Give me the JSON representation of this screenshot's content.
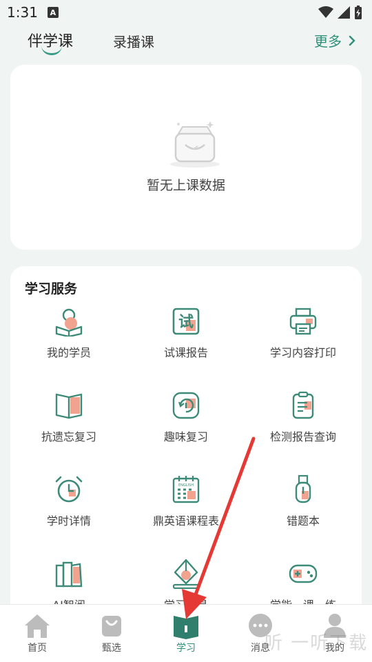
{
  "status_bar": {
    "time": "1:31",
    "notification_glyph": "A"
  },
  "tabs": {
    "items": [
      {
        "label": "伴学课"
      },
      {
        "label": "录播课"
      }
    ],
    "more_label": "更多",
    "more_arrow": "›"
  },
  "empty_state": {
    "text": "暂无上课数据"
  },
  "services": {
    "title": "学习服务",
    "items": [
      {
        "label": "我的学员",
        "icon": "student-reading-icon"
      },
      {
        "label": "试课报告",
        "icon": "trial-report-icon"
      },
      {
        "label": "学习内容打印",
        "icon": "printer-icon"
      },
      {
        "label": "抗遗忘复习",
        "icon": "open-book-icon"
      },
      {
        "label": "趣味复习",
        "icon": "review-cycle-icon"
      },
      {
        "label": "检测报告查询",
        "icon": "clipboard-icon"
      },
      {
        "label": "学时详情",
        "icon": "alarm-clock-icon"
      },
      {
        "label": "鼎英语课程表",
        "icon": "english-calendar-icon"
      },
      {
        "label": "错题本",
        "icon": "usb-drive-icon"
      },
      {
        "label": "AI智阅",
        "icon": "books-icon"
      },
      {
        "label": "学习工具",
        "icon": "pen-nib-icon"
      },
      {
        "label": "学能一课一练",
        "icon": "gamepad-icon"
      }
    ]
  },
  "bottom_nav": {
    "items": [
      {
        "label": "首页",
        "icon": "home-icon"
      },
      {
        "label": "甄选",
        "icon": "shopping-bag-icon"
      },
      {
        "label": "学习",
        "icon": "study-book-icon"
      },
      {
        "label": "消息",
        "icon": "message-bubble-icon"
      },
      {
        "label": "我的",
        "icon": "profile-icon"
      }
    ],
    "active_index": 2
  },
  "watermark": {
    "text": "听 一听下载"
  },
  "colors": {
    "accent": "#2f8f78",
    "icon_stroke": "#3d8a78",
    "icon_fill": "#f2a390",
    "annotation_arrow": "#e53935"
  }
}
